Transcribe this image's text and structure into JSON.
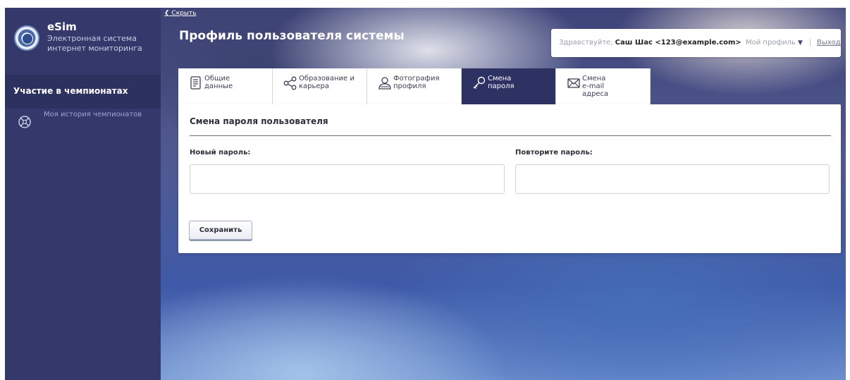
{
  "sidebar": {
    "brand_title": "eSim",
    "brand_subtitle": "Электронная система интернет мониторинга",
    "section_title": "Участие в чемпионатах",
    "items": [
      {
        "label": "Моя история чемпионатов",
        "icon": "championship-icon"
      }
    ]
  },
  "header": {
    "hide_label": "Скрыть",
    "page_title": "Профиль пользователя системы",
    "greeting": "Здравствуйте, ",
    "user_name": "Саш Шас <123@example.com>",
    "my_profile_label": "Мой профиль",
    "separator": "|",
    "logout_label": "Выход"
  },
  "tabs": [
    {
      "label": "Общие данные",
      "icon": "document-icon",
      "active": false
    },
    {
      "label": "Образование и карьера",
      "icon": "share-icon",
      "active": false
    },
    {
      "label": "Фотография профиля",
      "icon": "user-photo-icon",
      "active": false
    },
    {
      "label": "Смена пароля",
      "icon": "key-icon",
      "active": true
    },
    {
      "label": "Смена e-mail адреса",
      "icon": "mail-icon",
      "active": false
    }
  ],
  "form": {
    "title": "Смена пароля пользователя",
    "new_password_label": "Новый пароль:",
    "new_password_value": "",
    "repeat_password_label": "Повторите пароль:",
    "repeat_password_value": "",
    "save_label": "Сохранить"
  },
  "colors": {
    "sidebar_bg": "#34386a",
    "active_tab_bg": "#2e3263",
    "panel_bg": "#ffffff"
  }
}
